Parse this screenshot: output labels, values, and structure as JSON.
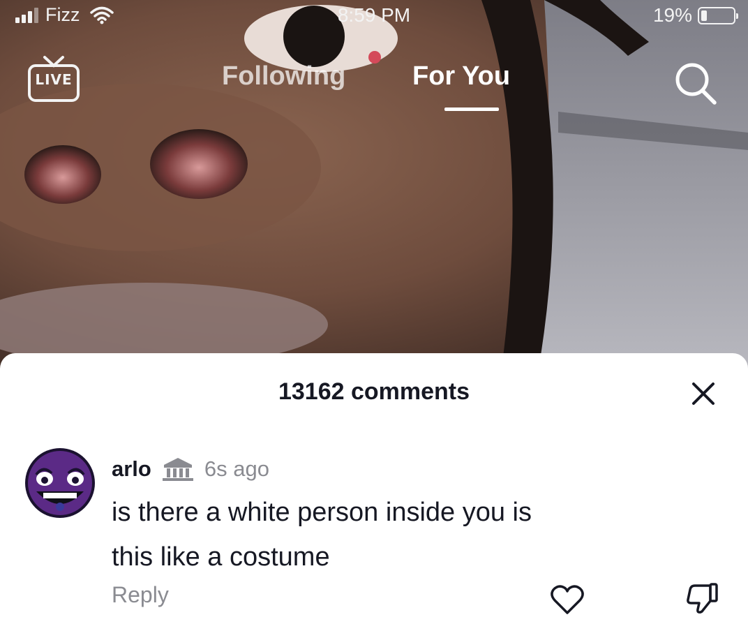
{
  "status_bar": {
    "carrier": "Fizz",
    "time": "8:59 PM",
    "battery_text": "19%",
    "battery_level": 0.19
  },
  "top_nav": {
    "live_label": "LIVE",
    "tabs": [
      {
        "label": "Following",
        "active": false
      },
      {
        "label": "For You",
        "active": true
      }
    ],
    "search_icon": "search-icon"
  },
  "comments_panel": {
    "count_text": "13162 comments",
    "close_icon": "close-icon",
    "comments": [
      {
        "username": "arlo",
        "badge_icon": "bank-building-icon",
        "time_ago": "6s ago",
        "text_line1": "is there a white person inside you is",
        "text_line2": "this like a costume",
        "reply_label": "Reply",
        "like_icon": "heart-icon",
        "dislike_icon": "thumbs-down-icon"
      }
    ]
  },
  "colors": {
    "text_primary": "#161823",
    "text_secondary": "#8a8b91",
    "sheet_background": "#ffffff",
    "avatar_purple": "#5b2a86"
  }
}
